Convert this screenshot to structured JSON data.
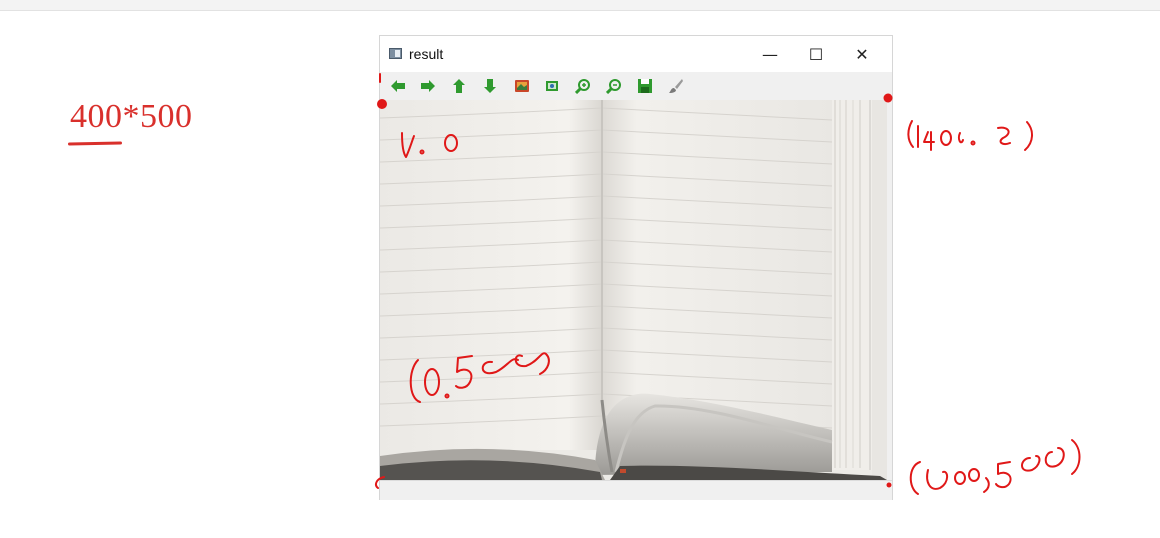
{
  "page": {
    "size_note": "400*500"
  },
  "window": {
    "title": "result",
    "buttons": {
      "minimize": "—",
      "maximize": "☐",
      "close": "✕"
    },
    "toolbar": [
      "arrow-left-icon",
      "arrow-right-icon",
      "arrow-up-icon",
      "arrow-down-icon",
      "image-icon",
      "zoom-fit-icon",
      "zoom-in-icon",
      "zoom-out-icon",
      "save-icon",
      "brush-icon"
    ]
  },
  "colors": {
    "annotation": "#d9302c",
    "toolbar_green": "#2f9a2f"
  }
}
